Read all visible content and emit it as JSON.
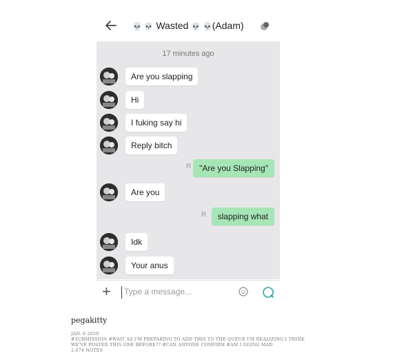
{
  "header": {
    "title_prefix": "💀 💀",
    "title_name": "Wasted",
    "title_suffix": "💀 💀",
    "title_tail": "(Adam)"
  },
  "chat": {
    "timestamp": "17 minutes ago",
    "messages": [
      {
        "direction": "in",
        "text": "Are you slapping"
      },
      {
        "direction": "in",
        "text": "Hi"
      },
      {
        "direction": "in",
        "text": "I fuking say hi"
      },
      {
        "direction": "in",
        "text": "Reply bitch"
      },
      {
        "direction": "out",
        "text": "\"Are you Slapping\"",
        "read_mark": "R"
      },
      {
        "direction": "in",
        "text": "Are you"
      },
      {
        "direction": "out",
        "text": "slapping what",
        "read_mark": "R"
      },
      {
        "direction": "in",
        "text": "Idk"
      },
      {
        "direction": "in",
        "text": "Your anus"
      }
    ]
  },
  "input": {
    "placeholder": "Type a message..."
  },
  "post": {
    "author": "pegakitty",
    "date": "JAN. 6 2020",
    "tags_line1": "#SUBMISSION  #WAIT AS I'M PREPARING TO ADD THIS TO THE QUEUE I'M REALIZING I THINK",
    "tags_line2": "WE'VE POSTED THIS ONE BEFORE??  #CAN ANYONE CONFIRM  #AM I GOING MAD",
    "notes": "2,474 NOTES"
  },
  "colors": {
    "outgoing_bubble": "#a6e6b6",
    "chat_background": "#e7e7e9",
    "send_icon": "#2aa5a0"
  }
}
